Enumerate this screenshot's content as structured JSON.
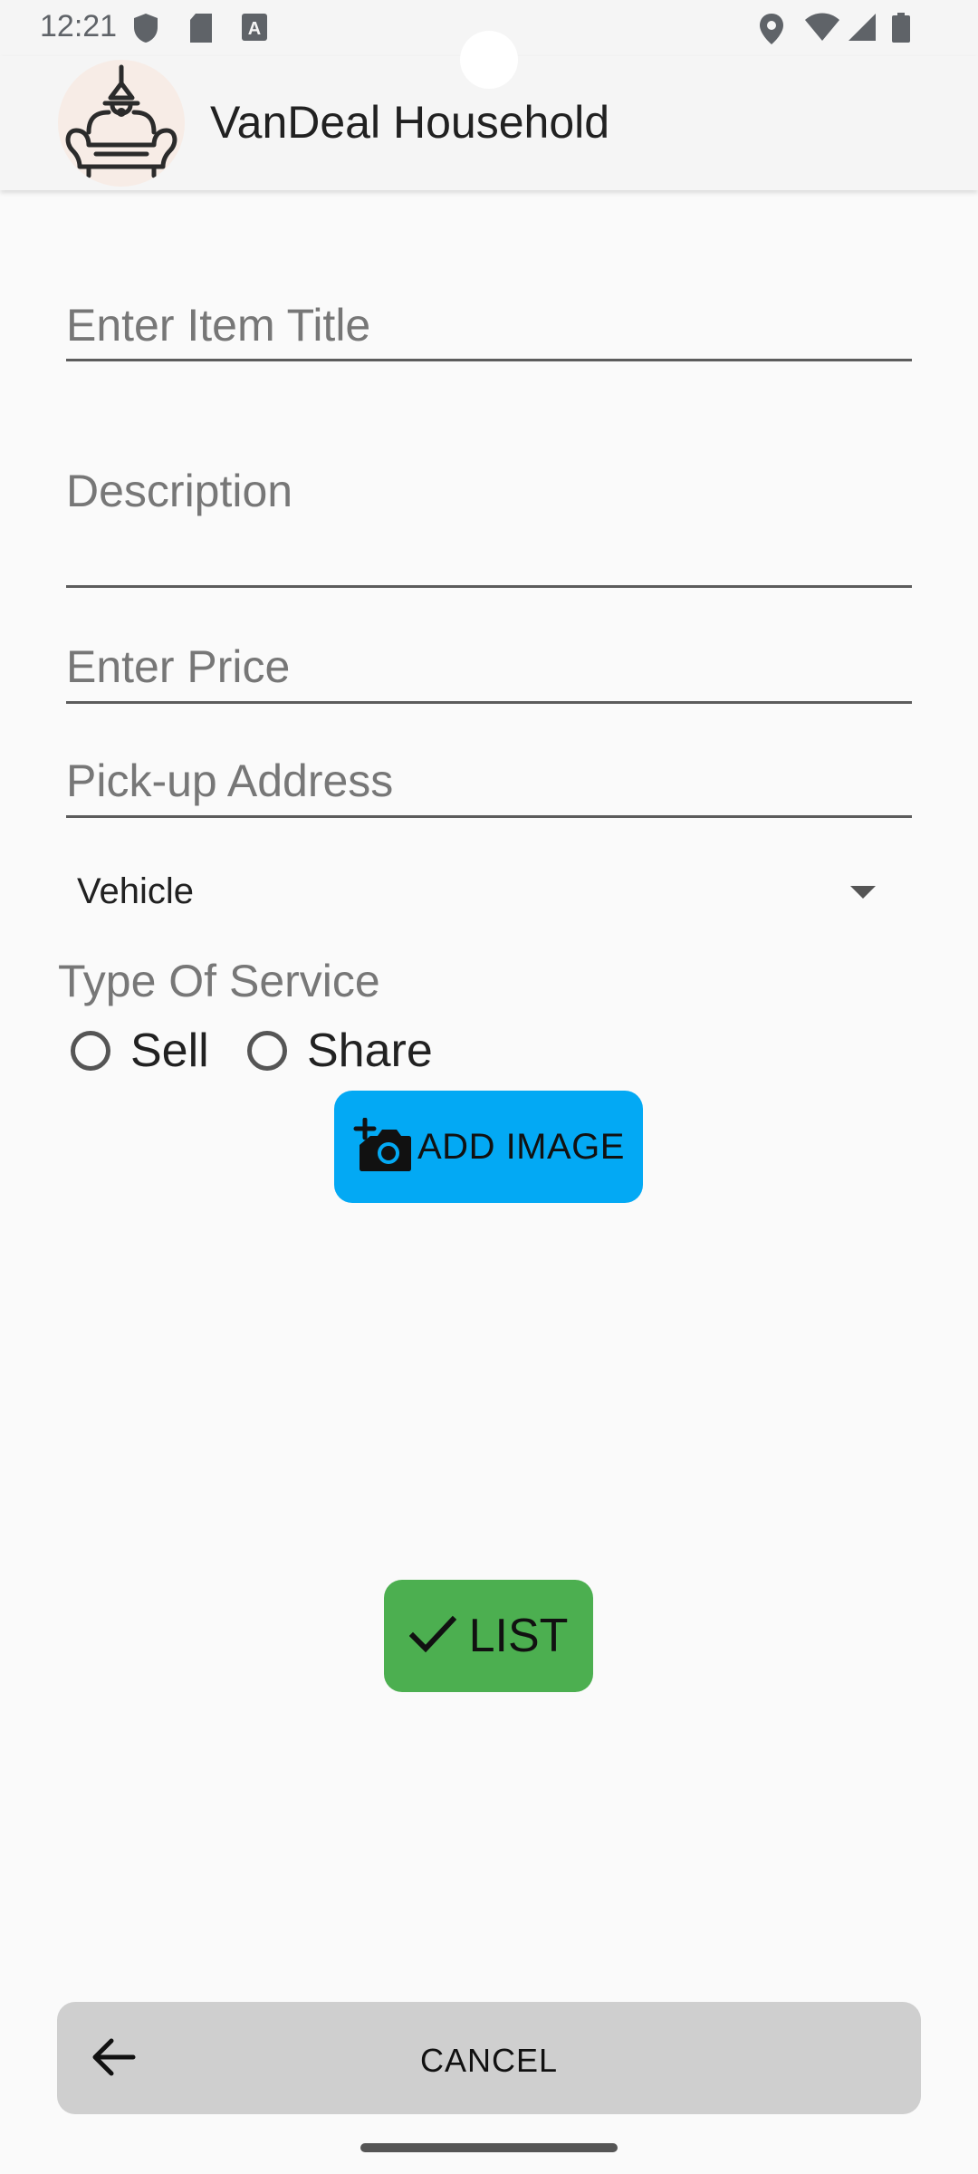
{
  "status_bar": {
    "time": "12:21"
  },
  "app_bar": {
    "title": "VanDeal Household"
  },
  "form": {
    "item_title": {
      "value": "",
      "placeholder": "Enter Item Title"
    },
    "description": {
      "value": "",
      "placeholder": "Description"
    },
    "price": {
      "value": "",
      "placeholder": "Enter Price"
    },
    "pickup_address": {
      "value": "",
      "placeholder": "Pick-up Address"
    },
    "category": {
      "selected": "Vehicle"
    },
    "service_type": {
      "label": "Type Of Service",
      "options": [
        {
          "label": "Sell",
          "selected": false
        },
        {
          "label": "Share",
          "selected": false
        }
      ]
    }
  },
  "buttons": {
    "add_image": "ADD IMAGE",
    "list": "LIST",
    "cancel": "CANCEL"
  },
  "colors": {
    "add_image_button": "#03a9f4",
    "list_button": "#4caf50",
    "cancel_button": "#cfcfcf",
    "background": "#fafafa"
  },
  "icons": {
    "add_image": "add-a-photo-icon",
    "list": "check-icon",
    "cancel": "arrow-back-icon"
  }
}
